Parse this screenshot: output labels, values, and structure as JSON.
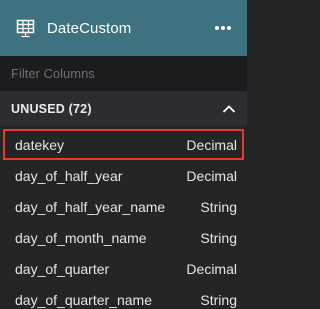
{
  "header": {
    "title": "DateCustom",
    "table_icon": "table-icon",
    "menu_icon": "more-horizontal-icon"
  },
  "filter": {
    "placeholder": "Filter Columns",
    "value": ""
  },
  "section": {
    "label": "UNUSED (72)",
    "chevron_icon": "chevron-up-icon"
  },
  "columns": [
    {
      "name": "datekey",
      "type": "Decimal"
    },
    {
      "name": "day_of_half_year",
      "type": "Decimal"
    },
    {
      "name": "day_of_half_year_name",
      "type": "String"
    },
    {
      "name": "day_of_month_name",
      "type": "String"
    },
    {
      "name": "day_of_quarter",
      "type": "Decimal"
    },
    {
      "name": "day_of_quarter_name",
      "type": "String"
    }
  ],
  "colors": {
    "header_bg": "#3f7280",
    "selection_outline": "#e53b2c",
    "panel_bg": "#232527"
  }
}
